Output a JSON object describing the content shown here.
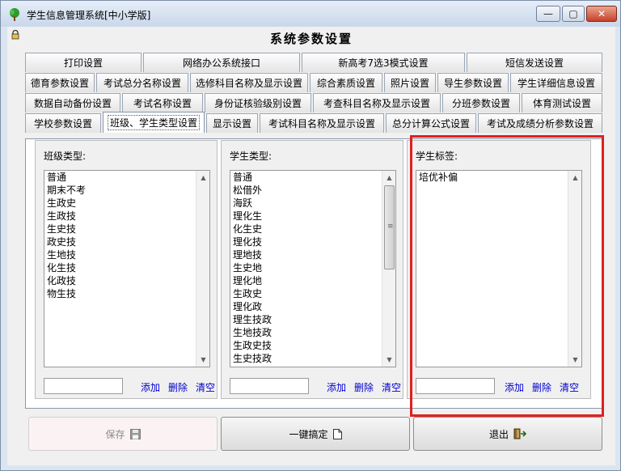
{
  "window": {
    "title": "学生信息管理系统[中小学版]",
    "min_label": "—",
    "max_label": "▢",
    "close_label": "✕"
  },
  "heading": "系统参数设置",
  "tabs": [
    [
      "打印设置",
      "网络办公系统接口",
      "新高考7选3模式设置",
      "短信发送设置"
    ],
    [
      "德育参数设置",
      "考试总分名称设置",
      "选修科目名称及显示设置",
      "综合素质设置",
      "照片设置",
      "导生参数设置",
      "学生详细信息设置"
    ],
    [
      "数据自动备份设置",
      "考试名称设置",
      "身份证核验级别设置",
      "考查科目名称及显示设置",
      "分班参数设置",
      "体育测试设置"
    ],
    [
      "学校参数设置",
      "班级、学生类型设置",
      "显示设置",
      "考试科目名称及显示设置",
      "总分计算公式设置",
      "考试及成绩分析参数设置"
    ]
  ],
  "groups": {
    "class_type": {
      "label": "班级类型:",
      "items": [
        "普通",
        "期末不考",
        "生政史",
        "生政技",
        "生史技",
        "政史技",
        "生地技",
        "化生技",
        "化政技",
        "物生技"
      ]
    },
    "student_type": {
      "label": "学生类型:",
      "items": [
        "普通",
        "松借外",
        "海跃",
        "理化生",
        "化生史",
        "理化技",
        "理地技",
        "生史地",
        "理化地",
        "生政史",
        "理化政",
        "理生技政",
        "生地技政",
        "生政史技",
        "生史技政"
      ]
    },
    "student_tag": {
      "label": "学生标签:",
      "items": [
        "培优补偏"
      ]
    }
  },
  "actions": {
    "add": "添加",
    "delete": "删除",
    "clear": "清空"
  },
  "buttons": {
    "save": "保存",
    "one_click": "一键搞定",
    "exit": "退出"
  },
  "icons": {
    "app": "tree-icon",
    "lock": "lock-icon",
    "save": "floppy-disk-icon",
    "one_click": "document-icon",
    "exit": "exit-door-icon"
  },
  "colors": {
    "link": "#0000d0",
    "highlight": "#e02020"
  }
}
